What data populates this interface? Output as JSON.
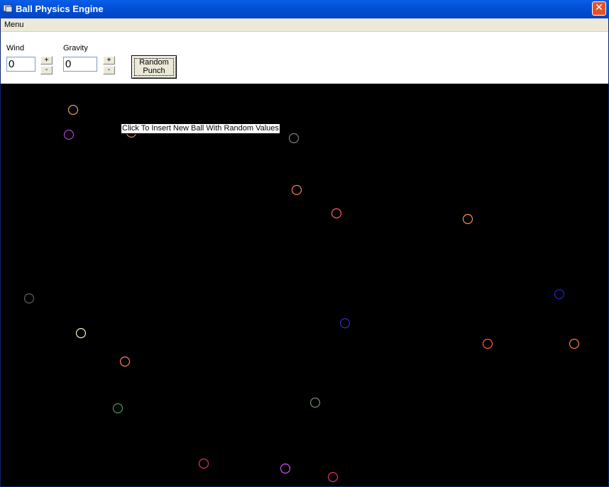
{
  "window": {
    "title": "Ball Physics Engine",
    "close_label": "✕"
  },
  "menu": {
    "items": [
      "Menu"
    ]
  },
  "controls": {
    "wind": {
      "label": "Wind",
      "value": "0",
      "plus": "+",
      "minus": "-"
    },
    "gravity": {
      "label": "Gravity",
      "value": "0",
      "plus": "+",
      "minus": "-"
    },
    "random_punch_line1": "Random",
    "random_punch_line2": "Punch"
  },
  "canvas": {
    "background": "#000000",
    "tooltip": "Click To Insert New Ball With Random Values",
    "balls": [
      {
        "color": "#e0a060"
      },
      {
        "color": "#b040d0"
      },
      {
        "color": "#e08070"
      },
      {
        "color": "#808080"
      },
      {
        "color": "#ff8040"
      },
      {
        "color": "#ff6070"
      },
      {
        "color": "#ff9040"
      },
      {
        "color": "#2020e0"
      },
      {
        "color": "#606060"
      },
      {
        "color": "#3030c0"
      },
      {
        "color": "#e0ffc0"
      },
      {
        "color": "#ff6040"
      },
      {
        "color": "#ff8030"
      },
      {
        "color": "#ff8060"
      },
      {
        "color": "#40a060"
      },
      {
        "color": "#709070"
      },
      {
        "color": "#e0306a"
      },
      {
        "color": "#d050ff"
      },
      {
        "color": "#e03060"
      }
    ]
  }
}
